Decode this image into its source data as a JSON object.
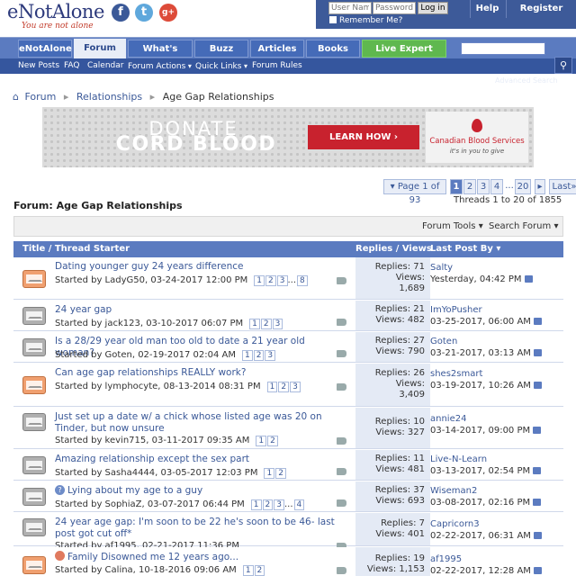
{
  "brand": {
    "name_e": "e",
    "name_rest": "NotAlone",
    "tagline": "You are not alone"
  },
  "social": {
    "facebook": "f",
    "twitter": "t",
    "google": "g+"
  },
  "login": {
    "username_placeholder": "User Name",
    "password_placeholder": "Password",
    "login_label": "Log in",
    "remember_label": "Remember Me?",
    "help_label": "Help",
    "register_label": "Register"
  },
  "nav": {
    "tabs": [
      "eNotAlone",
      "Forum",
      "What's New?",
      "Buzz",
      "Articles",
      "Books",
      "Live Expert Advice"
    ],
    "sub": [
      "New Posts",
      "FAQ",
      "Calendar",
      "Forum Actions",
      "Quick Links",
      "Forum Rules"
    ],
    "search_icon": "search-icon",
    "advanced_search": "Advanced Search"
  },
  "breadcrumb": {
    "items": [
      "Forum",
      "Relationships",
      "Age Gap Relationships"
    ]
  },
  "banner": {
    "line1": "DONATE",
    "line2": "CORD BLOOD",
    "cta": "LEARN HOW  ›",
    "org": "Canadian Blood Services",
    "org_tag": "it's in you to give"
  },
  "pagination": {
    "dropdown": "Page 1 of 93",
    "pages": [
      "1",
      "2",
      "3",
      "4",
      "...",
      "20",
      "Last"
    ],
    "thread_count": "Threads 1 to 20 of 1855"
  },
  "forum_title": "Forum: Age Gap Relationships",
  "tools": {
    "forum_tools": "Forum Tools",
    "search_forum": "Search Forum"
  },
  "table": {
    "col_title": "Title / Thread Starter",
    "col_stats": "Replies / Views",
    "col_last": "Last Post By"
  },
  "threads": [
    {
      "title": "Dating younger guy 24 years difference",
      "starter": "Started by LadyG50, 03-24-2017 12:00 PM",
      "pages": [
        "1",
        "2",
        "3",
        "...",
        "8"
      ],
      "replies": "Replies: 71",
      "views": "Views:",
      "views_n": "1,689",
      "last_user": "Salty",
      "last_date": "Yesterday, 04:42 PM",
      "icon": "orange"
    },
    {
      "title": "24 year gap",
      "starter": "Started by jack123, 03-10-2017 06:07 PM",
      "pages": [
        "1",
        "2",
        "3"
      ],
      "replies": "Replies: 21",
      "views": "Views: 482",
      "last_user": "ImYoPusher",
      "last_date": "03-25-2017, 06:00 AM",
      "icon": "gray"
    },
    {
      "title": "Is a 28/29 year old man too old to date a 21 year old woman?",
      "starter": "Started by Goten, 02-19-2017 02:04 AM",
      "pages": [
        "1",
        "2",
        "3"
      ],
      "replies": "Replies: 27",
      "views": "Views: 790",
      "last_user": "Goten",
      "last_date": "03-21-2017, 03:13 AM",
      "icon": "gray"
    },
    {
      "title": "Can age gap relationships REALLY work?",
      "starter": "Started by lymphocyte, 08-13-2014 08:31 PM",
      "pages": [
        "1",
        "2",
        "3"
      ],
      "replies": "Replies: 26",
      "views": "Views:",
      "views_n": "3,409",
      "last_user": "shes2smart",
      "last_date": "03-19-2017, 10:26 AM",
      "icon": "orange"
    },
    {
      "title": "Just set up a date w/ a chick whose listed age was 20 on Tinder, but now unsure",
      "starter": "Started by kevin715, 03-11-2017 09:35 AM",
      "pages": [
        "1",
        "2"
      ],
      "replies": "Replies: 10",
      "views": "Views: 327",
      "last_user": "annie24",
      "last_date": "03-14-2017, 09:00 PM",
      "icon": "gray"
    },
    {
      "title": "Amazing relationship except the sex part",
      "starter": "Started by Sasha4444, 03-05-2017 12:03 PM",
      "pages": [
        "1",
        "2"
      ],
      "replies": "Replies: 11",
      "views": "Views: 481",
      "last_user": "Live-N-Learn",
      "last_date": "03-13-2017, 02:54 PM",
      "icon": "gray"
    },
    {
      "title": "Lying about my age to a guy",
      "starter": "Started by SophiaZ, 03-07-2017 06:44 PM",
      "pages": [
        "1",
        "2",
        "3",
        "...",
        "4"
      ],
      "replies": "Replies: 37",
      "views": "Views: 693",
      "last_user": "Wiseman2",
      "last_date": "03-08-2017, 02:16 PM",
      "icon": "gray",
      "prefix": "?"
    },
    {
      "title": "24 year age gap: I'm soon to be 22 he's soon to be 46- last post got cut off*",
      "starter": "Started by af1995, 02-21-2017 11:36 PM",
      "pages": [],
      "replies": "Replies: 7",
      "views": "Views: 401",
      "last_user": "Capricorn3",
      "last_date": "02-22-2017, 06:31 AM",
      "icon": "gray"
    },
    {
      "title": "Family Disowned me 12 years ago...",
      "starter": "Started by Calina, 10-18-2016 09:06 AM",
      "pages": [
        "1",
        "2"
      ],
      "replies": "Replies: 19",
      "views": "Views: 1,153",
      "last_user": "af1995",
      "last_date": "02-22-2017, 12:28 AM",
      "icon": "orange",
      "prefix": "sad"
    }
  ],
  "colors": {
    "nav": "#5b7bc0",
    "accent": "#3b5998",
    "live": "#5fb84f",
    "banner_red": "#c8222e"
  }
}
